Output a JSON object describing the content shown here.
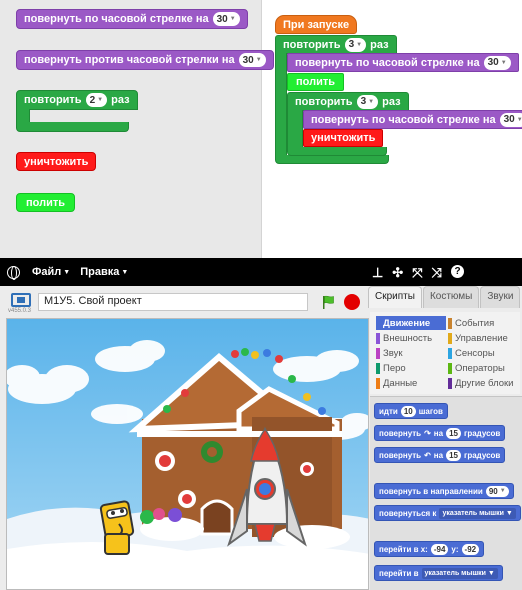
{
  "palette_blocks": {
    "rotate_cw": {
      "label": "повернуть по часовой стрелке на",
      "value": "30"
    },
    "rotate_ccw": {
      "label": "повернуть против часовой стрелки на",
      "value": "30"
    },
    "repeat": {
      "label": "повторить",
      "value": "2",
      "suffix": "раз"
    },
    "destroy": {
      "label": "уничтожить"
    },
    "weed": {
      "label": "полить"
    }
  },
  "script": {
    "hat": "При запуске",
    "outer_repeat": {
      "label": "повторить",
      "value": "3",
      "suffix": "раз"
    },
    "rotate1": {
      "label": "повернуть по часовой стрелке на",
      "value": "30"
    },
    "weed": "полить",
    "inner_repeat": {
      "label": "повторить",
      "value": "3",
      "suffix": "раз"
    },
    "rotate2": {
      "label": "повернуть по часовой стрелке на",
      "value": "30"
    },
    "destroy": "уничтожить"
  },
  "menubar": {
    "file": "Файл",
    "edit": "Правка"
  },
  "editor": {
    "version": "v455.0.3",
    "project_title": "М1У5. Свой проект",
    "tabs": [
      "Скрипты",
      "Костюмы",
      "Звуки"
    ],
    "categories_left": [
      "Движение",
      "Внешность",
      "Звук",
      "Перо",
      "Данные"
    ],
    "categories_right": [
      "События",
      "Управление",
      "Сенсоры",
      "Операторы",
      "Другие блоки"
    ],
    "category_colors": {
      "motion": "#4a6cd4",
      "looks": "#8a55d7",
      "sound": "#bb42c3",
      "pen": "#0e9a6c",
      "data": "#ee7d16",
      "events": "#c88330",
      "control": "#e1a91a",
      "sensing": "#2ca5e2",
      "operators": "#5cb712",
      "more": "#632d99"
    },
    "motion_blocks": {
      "move": {
        "label1": "идти",
        "value": "10",
        "label2": "шагов"
      },
      "turn_right": {
        "label1": "повернуть",
        "label2": "на",
        "value": "15",
        "label3": "градусов"
      },
      "turn_left": {
        "label1": "повернуть",
        "label2": "на",
        "value": "15",
        "label3": "градусов"
      },
      "point_dir": {
        "label": "повернуть в направлении",
        "value": "90"
      },
      "point_to": {
        "label": "повернуться к",
        "value": "указатель мышки"
      },
      "goto_xy": {
        "label1": "перейти в x:",
        "x": "-94",
        "label2": "y:",
        "y": "-92"
      },
      "goto": {
        "label": "перейти в",
        "value": "указатель мышки"
      }
    }
  }
}
